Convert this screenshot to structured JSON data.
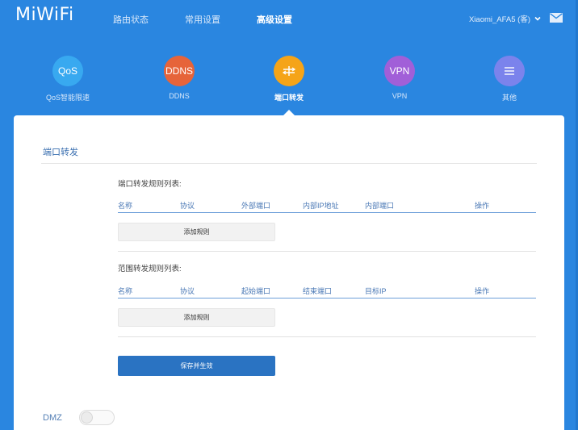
{
  "brand": {
    "logo": "MiWiFi"
  },
  "nav": {
    "items": [
      {
        "label": "路由状态",
        "active": false
      },
      {
        "label": "常用设置",
        "active": false
      },
      {
        "label": "高级设置",
        "active": true
      }
    ]
  },
  "device": {
    "name": "Xiaomi_AFA5 (客)"
  },
  "icons": {
    "chevron": "chevron-down-icon",
    "mail": "mail-icon",
    "port_forward": "port-forward-icon",
    "menu": "menu-icon"
  },
  "categories": [
    {
      "icon_text": "QoS",
      "label": "QoS智能限速",
      "color": "#38a9f0"
    },
    {
      "icon_text": "DDNS",
      "label": "DDNS",
      "color": "#e6643a"
    },
    {
      "icon_text": "",
      "label": "端口转发",
      "color": "#f5a418",
      "active": true
    },
    {
      "icon_text": "VPN",
      "label": "VPN",
      "color": "#a15fd8"
    },
    {
      "icon_text": "",
      "label": "其他",
      "color": "#7b83ec"
    }
  ],
  "panel": {
    "section_title": "端口转发",
    "port_rules": {
      "title": "端口转发规则列表:",
      "columns": [
        "名称",
        "协议",
        "外部端口",
        "内部IP地址",
        "内部端口",
        "操作"
      ],
      "add_label": "添加规则"
    },
    "range_rules": {
      "title": "范围转发规则列表:",
      "columns": [
        "名称",
        "协议",
        "起始端口",
        "结束端口",
        "目标IP",
        "操作"
      ],
      "add_label": "添加规则"
    },
    "save_label": "保存并生效",
    "dmz": {
      "label": "DMZ",
      "enabled": false
    }
  }
}
